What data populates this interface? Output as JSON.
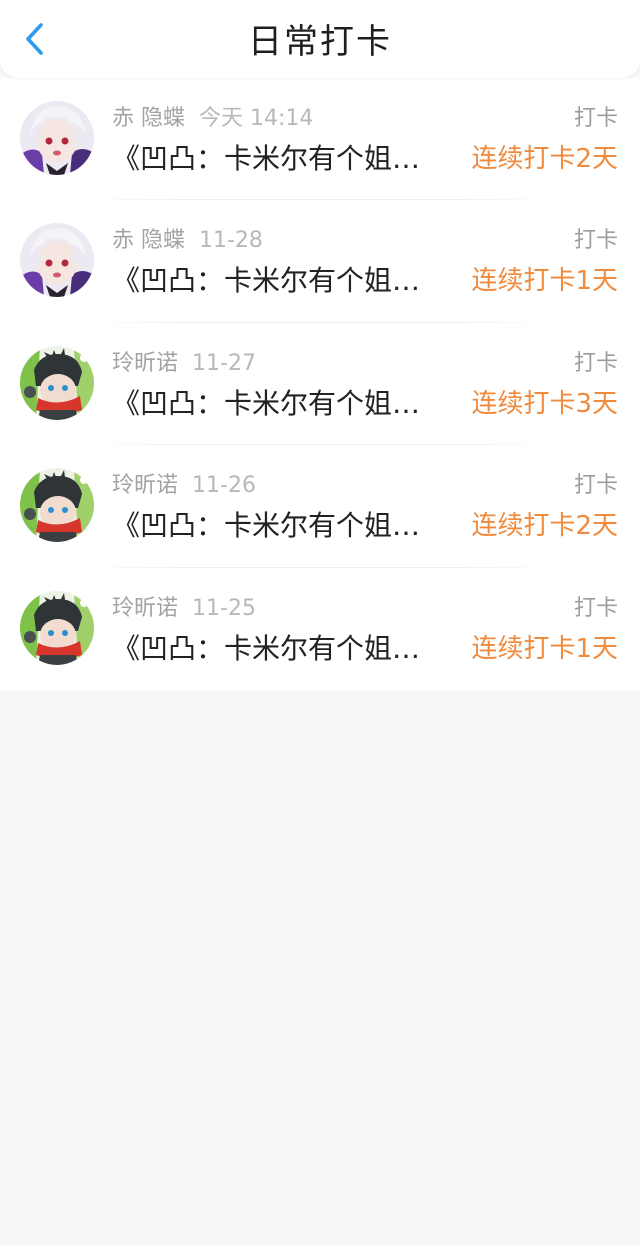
{
  "header": {
    "title": "日常打卡",
    "back_icon": "chevron-left-icon"
  },
  "colors": {
    "accent_orange": "#f08a3d",
    "back_blue": "#2d9bf0",
    "meta_gray": "#a3a3a3",
    "page_background": "#f8f7f8"
  },
  "items": [
    {
      "user": "赤 隐蝶",
      "date": "今天 14:14",
      "type": "打卡",
      "content": "《凹凸：卡米尔有个姐…",
      "streak": "连续打卡2天",
      "avatar": "avatar-white-hair"
    },
    {
      "user": "赤 隐蝶",
      "date": "11-28",
      "type": "打卡",
      "content": "《凹凸：卡米尔有个姐…",
      "streak": "连续打卡1天",
      "avatar": "avatar-white-hair"
    },
    {
      "user": "玲昕诺",
      "date": "11-27",
      "type": "打卡",
      "content": "《凹凸：卡米尔有个姐…",
      "streak": "连续打卡3天",
      "avatar": "avatar-green-dark"
    },
    {
      "user": "玲昕诺",
      "date": "11-26",
      "type": "打卡",
      "content": "《凹凸：卡米尔有个姐…",
      "streak": "连续打卡2天",
      "avatar": "avatar-green-dark"
    },
    {
      "user": "玲昕诺",
      "date": "11-25",
      "type": "打卡",
      "content": "《凹凸：卡米尔有个姐…",
      "streak": "连续打卡1天",
      "avatar": "avatar-green-dark"
    }
  ]
}
